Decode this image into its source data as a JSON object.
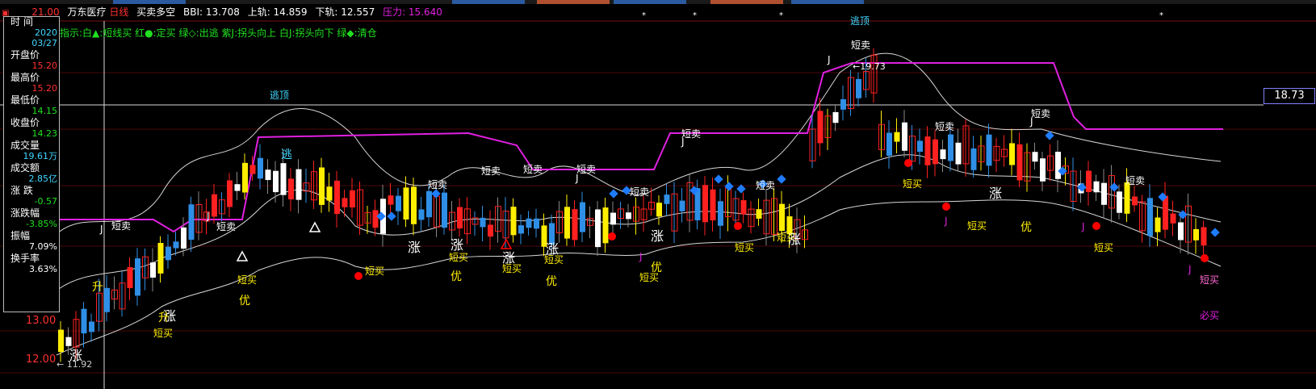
{
  "colors": {
    "rise": "#ff2020",
    "fall": "#2f8fe6",
    "yellow": "#ffee00",
    "magenta": "#e020e0",
    "band": "#d8d8d8",
    "white": "#ffffff",
    "red_dot": "#ff0000",
    "blue_dia": "#1e7cff",
    "cyan": "#40d8ff"
  },
  "header": {
    "menu_icon": "grid-icon",
    "stock_name": "万东医疗",
    "period": "日线",
    "indicator_name": "买卖多空",
    "bbi": "BBI: 13.708",
    "upper_label": "上轨: 14.859",
    "lower_label": "下轨: 12.557",
    "pressure": "压力: 15.640"
  },
  "legend_line": "指示:白▲:短线买 红●:定买 绿◇:出逃 紫J:拐头向上 白J:拐头向下 绿◆:清仓",
  "info_panel": {
    "time_label": "时 间",
    "year": "2020",
    "date": "03/27",
    "open_label": "开盘价",
    "open": "15.20",
    "high_label": "最高价",
    "high": "15.20",
    "low_label": "最低价",
    "low": "14.15",
    "close_label": "收盘价",
    "close": "14.23",
    "volume_label": "成交量",
    "volume": "19.61万",
    "amount_label": "成交额",
    "amount": "2.85亿",
    "change_label": "涨 跌",
    "change": "-0.57",
    "pct_label": "涨跌幅",
    "pct": "-3.85%",
    "amp_label": "振幅",
    "amp": "7.09%",
    "turn_label": "换手率",
    "turn": "3.63%"
  },
  "y_axis": {
    "top": "21.00",
    "mid": "13.00",
    "bot": "12.00"
  },
  "current_price": "18.73",
  "max_label": "←19.73",
  "min_label": "← 11.92",
  "sig": {
    "tuichu": "逃顶",
    "duanmai": "短卖",
    "duanmai2": "短买",
    "zhang": "涨",
    "you": "优",
    "sheng": "升",
    "bimai": "必买",
    "tao": "逃",
    "j": "J"
  }
}
